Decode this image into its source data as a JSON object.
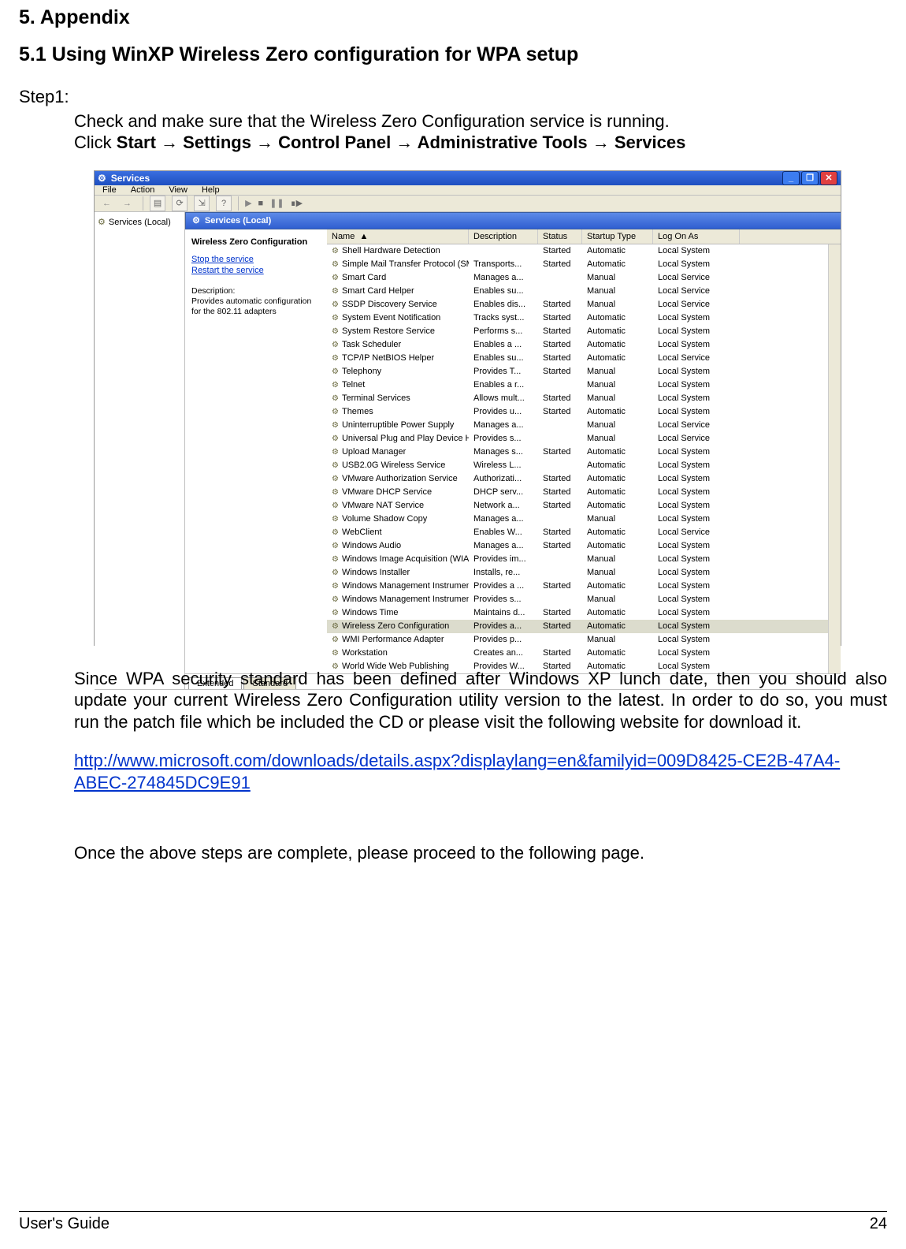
{
  "doc": {
    "h_appendix": "5. Appendix",
    "h_section": "5.1 Using WinXP Wireless Zero configuration for WPA setup",
    "step1_label": "Step1:",
    "step1_line1": "Check and make sure that the Wireless Zero Configuration service is running.",
    "nav_prefix": "Click ",
    "nav": {
      "p1": "Start",
      "p2": "Settings",
      "p3": "Control Panel",
      "p4": "Administrative Tools",
      "p5": "Services",
      "arrow": " → "
    },
    "para_after": "Since WPA security standard has been defined after Windows XP lunch date, then you should also update your current Wireless Zero Configuration utility version to the latest. In order to do so, you must run the patch file which be included the CD or please visit the following website for download it.",
    "url": "http://www.microsoft.com/downloads/details.aspx?displaylang=en&familyid=009D8425-CE2B-47A4-ABEC-274845DC9E91",
    "para_final": "Once the above steps are complete, please proceed to the following page.",
    "footer_left": "User's Guide",
    "footer_right": "24"
  },
  "shot": {
    "title": "Services",
    "menus": [
      "File",
      "Action",
      "View",
      "Help"
    ],
    "tree_root": "Services (Local)",
    "panel_header": "Services (Local)",
    "detail": {
      "svc_name": "Wireless Zero Configuration",
      "stop": "Stop the service",
      "restart": "Restart the service",
      "desc_label": "Description:",
      "desc": "Provides automatic configuration for the 802.11 adapters"
    },
    "cols": {
      "name": "Name",
      "desc": "Description",
      "status": "Status",
      "startup": "Startup Type",
      "logon": "Log On As"
    },
    "tabs": {
      "extended": "Extended",
      "standard": "Standard"
    },
    "rows": [
      {
        "name": "Shell Hardware Detection",
        "desc": "",
        "status": "Started",
        "startup": "Automatic",
        "logon": "Local System"
      },
      {
        "name": "Simple Mail Transfer Protocol (SMTP)",
        "desc": "Transports...",
        "status": "Started",
        "startup": "Automatic",
        "logon": "Local System"
      },
      {
        "name": "Smart Card",
        "desc": "Manages a...",
        "status": "",
        "startup": "Manual",
        "logon": "Local Service"
      },
      {
        "name": "Smart Card Helper",
        "desc": "Enables su...",
        "status": "",
        "startup": "Manual",
        "logon": "Local Service"
      },
      {
        "name": "SSDP Discovery Service",
        "desc": "Enables dis...",
        "status": "Started",
        "startup": "Manual",
        "logon": "Local Service"
      },
      {
        "name": "System Event Notification",
        "desc": "Tracks syst...",
        "status": "Started",
        "startup": "Automatic",
        "logon": "Local System"
      },
      {
        "name": "System Restore Service",
        "desc": "Performs s...",
        "status": "Started",
        "startup": "Automatic",
        "logon": "Local System"
      },
      {
        "name": "Task Scheduler",
        "desc": "Enables a ...",
        "status": "Started",
        "startup": "Automatic",
        "logon": "Local System"
      },
      {
        "name": "TCP/IP NetBIOS Helper",
        "desc": "Enables su...",
        "status": "Started",
        "startup": "Automatic",
        "logon": "Local Service"
      },
      {
        "name": "Telephony",
        "desc": "Provides T...",
        "status": "Started",
        "startup": "Manual",
        "logon": "Local System"
      },
      {
        "name": "Telnet",
        "desc": "Enables a r...",
        "status": "",
        "startup": "Manual",
        "logon": "Local System"
      },
      {
        "name": "Terminal Services",
        "desc": "Allows mult...",
        "status": "Started",
        "startup": "Manual",
        "logon": "Local System"
      },
      {
        "name": "Themes",
        "desc": "Provides u...",
        "status": "Started",
        "startup": "Automatic",
        "logon": "Local System"
      },
      {
        "name": "Uninterruptible Power Supply",
        "desc": "Manages a...",
        "status": "",
        "startup": "Manual",
        "logon": "Local Service"
      },
      {
        "name": "Universal Plug and Play Device Host",
        "desc": "Provides s...",
        "status": "",
        "startup": "Manual",
        "logon": "Local Service"
      },
      {
        "name": "Upload Manager",
        "desc": "Manages s...",
        "status": "Started",
        "startup": "Automatic",
        "logon": "Local System"
      },
      {
        "name": "USB2.0G Wireless Service",
        "desc": "Wireless L...",
        "status": "",
        "startup": "Automatic",
        "logon": "Local System"
      },
      {
        "name": "VMware Authorization Service",
        "desc": "Authorizati...",
        "status": "Started",
        "startup": "Automatic",
        "logon": "Local System"
      },
      {
        "name": "VMware DHCP Service",
        "desc": "DHCP serv...",
        "status": "Started",
        "startup": "Automatic",
        "logon": "Local System"
      },
      {
        "name": "VMware NAT Service",
        "desc": "Network a...",
        "status": "Started",
        "startup": "Automatic",
        "logon": "Local System"
      },
      {
        "name": "Volume Shadow Copy",
        "desc": "Manages a...",
        "status": "",
        "startup": "Manual",
        "logon": "Local System"
      },
      {
        "name": "WebClient",
        "desc": "Enables W...",
        "status": "Started",
        "startup": "Automatic",
        "logon": "Local Service"
      },
      {
        "name": "Windows Audio",
        "desc": "Manages a...",
        "status": "Started",
        "startup": "Automatic",
        "logon": "Local System"
      },
      {
        "name": "Windows Image Acquisition (WIA)",
        "desc": "Provides im...",
        "status": "",
        "startup": "Manual",
        "logon": "Local System"
      },
      {
        "name": "Windows Installer",
        "desc": "Installs, re...",
        "status": "",
        "startup": "Manual",
        "logon": "Local System"
      },
      {
        "name": "Windows Management Instrumenta...",
        "desc": "Provides a ...",
        "status": "Started",
        "startup": "Automatic",
        "logon": "Local System"
      },
      {
        "name": "Windows Management Instrumenta...",
        "desc": "Provides s...",
        "status": "",
        "startup": "Manual",
        "logon": "Local System"
      },
      {
        "name": "Windows Time",
        "desc": "Maintains d...",
        "status": "Started",
        "startup": "Automatic",
        "logon": "Local System"
      },
      {
        "name": "Wireless Zero Configuration",
        "desc": "Provides a...",
        "status": "Started",
        "startup": "Automatic",
        "logon": "Local System",
        "selected": true
      },
      {
        "name": "WMI Performance Adapter",
        "desc": "Provides p...",
        "status": "",
        "startup": "Manual",
        "logon": "Local System"
      },
      {
        "name": "Workstation",
        "desc": "Creates an...",
        "status": "Started",
        "startup": "Automatic",
        "logon": "Local System"
      },
      {
        "name": "World Wide Web Publishing",
        "desc": "Provides W...",
        "status": "Started",
        "startup": "Automatic",
        "logon": "Local System"
      }
    ]
  }
}
